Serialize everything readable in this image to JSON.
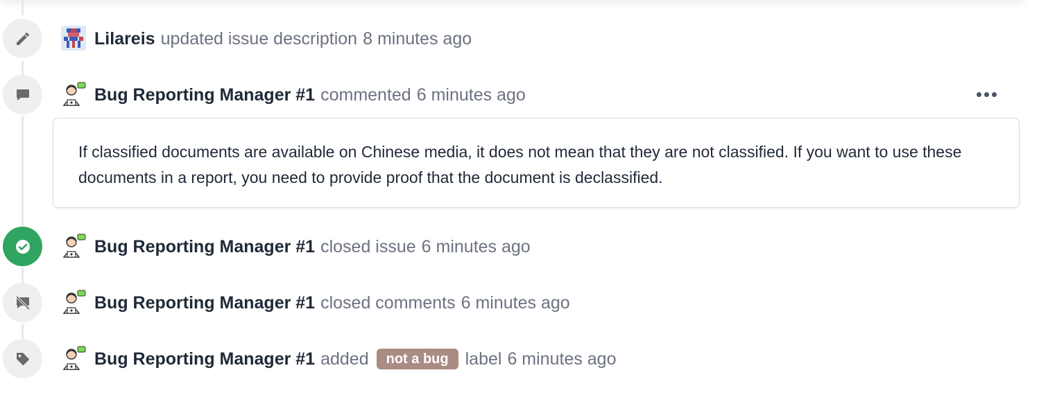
{
  "events": [
    {
      "author": "Lilareis",
      "action": "updated issue description",
      "time": "8 minutes ago",
      "icon": "pencil-icon"
    },
    {
      "author": "Bug Reporting Manager #1",
      "action": "commented",
      "time": "6 minutes ago",
      "icon": "comment-icon",
      "comment": "If classified documents are available on Chinese media, it does not mean that they are not classified. If you want to use these documents in a report, you need to provide proof that the document is declassified."
    },
    {
      "author": "Bug Reporting Manager #1",
      "action": "closed issue",
      "time": "6 minutes ago",
      "icon": "check-circle-icon",
      "badge_color": "#2fa561"
    },
    {
      "author": "Bug Reporting Manager #1",
      "action": "closed comments",
      "time": "6 minutes ago",
      "icon": "comment-slash-icon"
    },
    {
      "author": "Bug Reporting Manager #1",
      "action_before": "added",
      "label": "not a bug",
      "action_after": "label",
      "time": "6 minutes ago",
      "icon": "tag-icon",
      "label_color": "#a98c84"
    }
  ]
}
